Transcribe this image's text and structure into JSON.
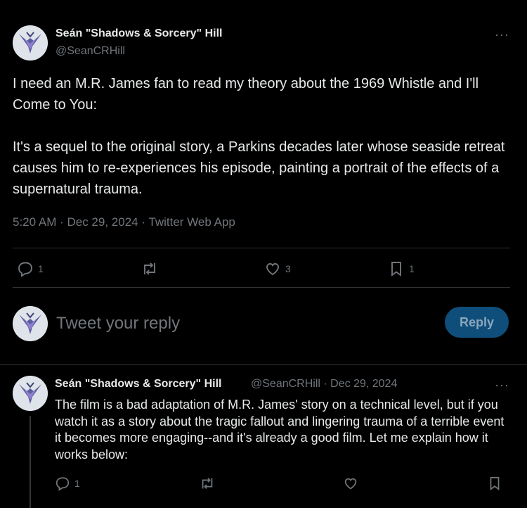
{
  "main_tweet": {
    "author_name": "Seán \"Shadows & Sorcery\" Hill",
    "handle": "@SeanCRHill",
    "more": "···",
    "text": "I need an M.R. James fan to read my theory about the 1969 Whistle and I'll Come to You:\n\nIt's a sequel to the original story, a Parkins decades later whose seaside retreat causes him to re-experiences his episode, painting a portrait of the effects of a supernatural trauma.",
    "timestamp": "5:20 AM · Dec 29, 2024 · Twitter Web App",
    "actions": {
      "reply_count": "1",
      "retweet_count": "",
      "like_count": "3",
      "bookmark_count": "1"
    }
  },
  "reply_composer": {
    "placeholder": "Tweet your reply",
    "button_label": "Reply"
  },
  "reply_tweet": {
    "author_name": "Seán \"Shadows & Sorcery\" Hill",
    "handle_date": "@SeanCRHill · Dec 29, 2024",
    "more": "···",
    "text": "The film is a bad adaptation of M.R. James' story on a technical level, but if you watch it as a story about the tragic fallout and lingering trauma of a terrible event it becomes more engaging--and it's already a good film. Let me explain how it works below:",
    "actions": {
      "reply_count": "1"
    }
  },
  "colors": {
    "background": "#000000",
    "text": "#e7e9ea",
    "secondary": "#71767b",
    "divider": "#2f3336",
    "reply_button": "#0f4e7a"
  },
  "icons": {
    "avatar": "wizard-avatar-icon",
    "reply": "reply-icon",
    "retweet": "retweet-icon",
    "like": "heart-icon",
    "bookmark": "bookmark-icon",
    "more": "more-icon"
  }
}
